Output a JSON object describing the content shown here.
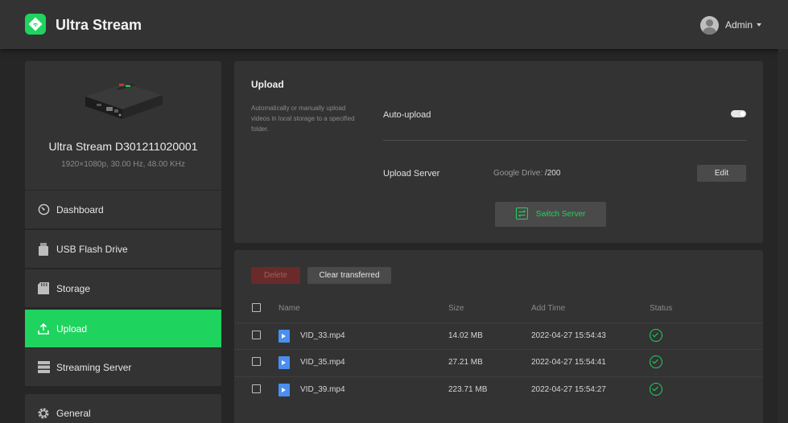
{
  "header": {
    "app_title": "Ultra Stream",
    "user_name": "Admin",
    "logo_icon": "wifi-diamond-icon"
  },
  "colors": {
    "accent": "#1fd35f",
    "background": "#262626",
    "panel": "#333333",
    "danger": "#6b2a2a",
    "file_icon": "#4a8ef0"
  },
  "device": {
    "name": "Ultra Stream D301211020001",
    "spec": "1920×1080p, 30.00 Hz, 48.00 KHz"
  },
  "sidebar": {
    "items": [
      {
        "label": "Dashboard",
        "icon": "dashboard-icon",
        "active": false
      },
      {
        "label": "USB Flash Drive",
        "icon": "usb-drive-icon",
        "active": false
      },
      {
        "label": "Storage",
        "icon": "sd-card-icon",
        "active": false
      },
      {
        "label": "Upload",
        "icon": "upload-icon",
        "active": true
      },
      {
        "label": "Streaming Server",
        "icon": "server-icon",
        "active": false
      },
      {
        "label": "General",
        "icon": "gear-icon",
        "active": false
      }
    ]
  },
  "upload_settings": {
    "title": "Upload",
    "description": "Automatically or manually upload videos in local storage to a specified folder.",
    "auto_upload_label": "Auto-upload",
    "auto_upload_enabled": true,
    "server_label": "Upload Server",
    "server_name": "Google Drive:",
    "server_path": "/200",
    "edit_label": "Edit",
    "switch_label": "Switch Server"
  },
  "files": {
    "delete_label": "Delete",
    "clear_label": "Clear transferred",
    "columns": [
      "Name",
      "Size",
      "Add Time",
      "Status"
    ],
    "rows": [
      {
        "name": "VID_33.mp4",
        "size": "14.02 MB",
        "time": "2022-04-27 15:54:43",
        "status": "check-circle-icon"
      },
      {
        "name": "VID_35.mp4",
        "size": "27.21 MB",
        "time": "2022-04-27 15:54:41",
        "status": "check-circle-icon"
      },
      {
        "name": "VID_39.mp4",
        "size": "223.71 MB",
        "time": "2022-04-27 15:54:27",
        "status": "check-circle-icon"
      }
    ]
  }
}
